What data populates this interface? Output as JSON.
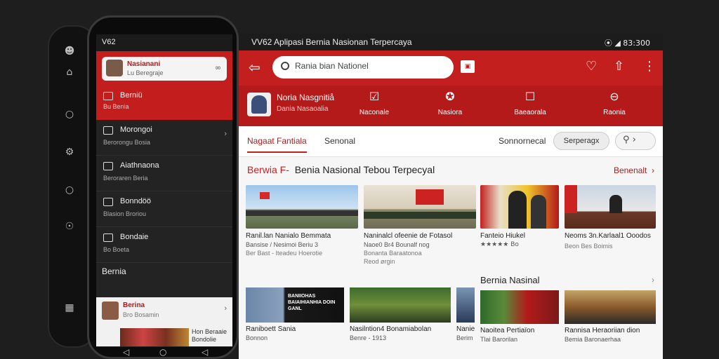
{
  "back_phone": {
    "icons": [
      "user-icon",
      "home-icon",
      "circle-icon",
      "settings-icon",
      "circle-icon",
      "compass-icon",
      "grid-icon"
    ]
  },
  "phone": {
    "status": "V62",
    "card": {
      "title": "Nasianani",
      "subtitle": "Lu Beregraje"
    },
    "top_item": {
      "title": "Berniü",
      "subtitle": "Bu Benia"
    },
    "items": [
      {
        "title": "Morongoi",
        "subtitle": "Berorongu Bosia"
      },
      {
        "title": "Aiathnaona",
        "subtitle": "Beroraren Beria"
      },
      {
        "title": "Bonndöö",
        "subtitle": "Blasion Broriou"
      },
      {
        "title": "Bondaie",
        "subtitle": "Bo Boeta"
      }
    ],
    "section_label": "Bernia",
    "bottom_card": {
      "title": "Berina",
      "subtitle": "Bro Bosamin",
      "side_text": "Hon Beraaie Bondolie"
    }
  },
  "tablet": {
    "status_title": "VV62 Aplipasi Bernia Nasionan Terpercaya",
    "status_right": "⦿ ◢ 83:300",
    "search_value": "Rania bian Nationel",
    "profile": {
      "name": "Noria Nasgnitiå",
      "sub": "Dania Nasaoalia"
    },
    "categories": [
      {
        "icon": "☑",
        "label": "Naconale"
      },
      {
        "icon": "✪",
        "label": "Nasiora"
      },
      {
        "icon": "☐",
        "label": "Baeaorala"
      },
      {
        "icon": "⊖",
        "label": "Raonia"
      }
    ],
    "tabs": [
      "Nagaat Fantiala",
      "Senonal",
      "Sonnornecal"
    ],
    "pill": "Serperagx",
    "section1": {
      "red": "Berwia F-",
      "title": "Benia Nasional Tebou Terpecyal",
      "right": "Benenalt"
    },
    "cards": [
      {
        "t1": "Ranil.lan Nanialo Bemmata",
        "t2": "Bansise / Nesimoi Beriu 3",
        "t3": "Ber Bast - Iteadeu Hoerotie"
      },
      {
        "t1": "Naninalcl ofeenie de Fotasol",
        "t2": "Naoe0 Br4 Bounalf nog",
        "t3": "Bonanta Baraatonoa",
        "t4": "Reod ørgin"
      },
      {
        "t1": "Fanteio Hiukel",
        "t2": "★★★★★ Bo",
        "t3": ""
      },
      {
        "t1": "Neoms 3n.Karlaal1 Ooodos",
        "t2": "",
        "t3": "Beon Bes Boimis"
      }
    ],
    "section2": "Bernia Nasinal",
    "cards2": [
      {
        "t1": "Raniboett Sania",
        "t2": "Bonnon",
        "overlay": "BANIIOHAS BAIAIHIANHIA DOIN GANL"
      },
      {
        "t1": "Nasilntion4 Bonamiabolan",
        "t2": "Benre - 1913"
      },
      {
        "t1": "Nanie",
        "t2": "Berim"
      },
      {
        "t1": "Naoitea Pertiaïon",
        "t2": "Tlai Barorilan"
      },
      {
        "t1": "Rannisa Heraoriian dion",
        "t2": "Bemia Baronaerhaa"
      }
    ]
  }
}
